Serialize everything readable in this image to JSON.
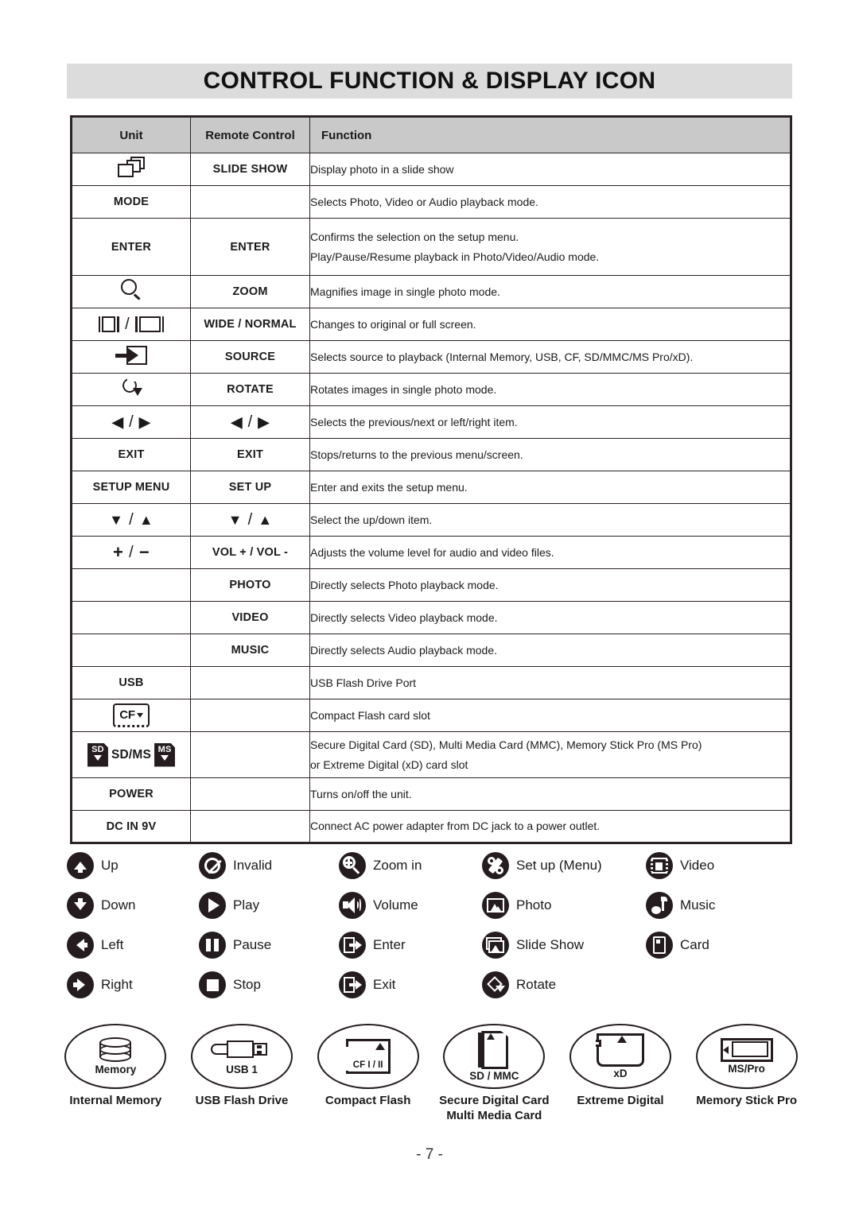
{
  "header": {
    "title": "CONTROL FUNCTION & DISPLAY ICON"
  },
  "table": {
    "columns": [
      "Unit",
      "Remote Control",
      "Function"
    ],
    "rows": [
      {
        "unit_icon": "slideshow-stack-icon",
        "unit": "",
        "remote": "SLIDE SHOW",
        "function": [
          "Display photo in a slide show"
        ]
      },
      {
        "unit_icon": "",
        "unit": "MODE",
        "remote": "",
        "function": [
          "Selects Photo, Video or Audio playback mode."
        ]
      },
      {
        "unit_icon": "",
        "unit": "ENTER",
        "remote": "ENTER",
        "function": [
          "Confirms the selection on the setup menu.",
          "Play/Pause/Resume playback in Photo/Video/Audio mode."
        ]
      },
      {
        "unit_icon": "magnifier-icon",
        "unit": "",
        "remote": "ZOOM",
        "function": [
          "Magnifies image in single photo mode."
        ]
      },
      {
        "unit_icon": "wide-normal-screen-icon",
        "unit": "",
        "remote": "WIDE / NORMAL",
        "function": [
          "Changes to original or full screen."
        ]
      },
      {
        "unit_icon": "source-arrow-icon",
        "unit": "",
        "remote": "SOURCE",
        "function": [
          "Selects source to playback (Internal Memory, USB, CF, SD/MMC/MS Pro/xD)."
        ]
      },
      {
        "unit_icon": "rotate-icon",
        "unit": "",
        "remote": "ROTATE",
        "function": [
          "Rotates images in single photo mode."
        ]
      },
      {
        "unit_icon": "left-right-arrows-icon",
        "unit": "",
        "remote_icon": "left-right-arrows-icon",
        "remote": "",
        "function": [
          "Selects the previous/next or left/right item."
        ]
      },
      {
        "unit_icon": "",
        "unit": "EXIT",
        "remote": "EXIT",
        "function": [
          "Stops/returns to the previous menu/screen."
        ]
      },
      {
        "unit_icon": "",
        "unit": "SETUP MENU",
        "remote": "SET UP",
        "function": [
          "Enter and exits the setup menu."
        ]
      },
      {
        "unit_icon": "down-up-arrows-icon",
        "unit": "",
        "remote_icon": "down-up-arrows-icon",
        "remote": "",
        "function": [
          "Select the up/down item."
        ]
      },
      {
        "unit_icon": "plus-minus-icon",
        "unit": "",
        "remote": "VOL + / VOL -",
        "function": [
          "Adjusts the volume level for audio and video files."
        ]
      },
      {
        "unit_icon": "",
        "unit": "",
        "remote": "PHOTO",
        "function": [
          "Directly selects Photo playback mode."
        ]
      },
      {
        "unit_icon": "",
        "unit": "",
        "remote": "VIDEO",
        "function": [
          "Directly selects Video playback mode."
        ]
      },
      {
        "unit_icon": "",
        "unit": "",
        "remote": "MUSIC",
        "function": [
          "Directly selects Audio playback mode."
        ]
      },
      {
        "unit_icon": "",
        "unit": "USB",
        "remote": "",
        "function": [
          "USB Flash Drive Port"
        ]
      },
      {
        "unit_icon": "cf-slot-icon",
        "unit": "",
        "remote": "",
        "function": [
          "Compact Flash card slot"
        ]
      },
      {
        "unit_icon": "sd-ms-slot-icon",
        "unit": "SD/MS",
        "remote": "",
        "function": [
          "Secure Digital Card (SD), Multi Media Card (MMC), Memory Stick Pro (MS Pro)",
          "or Extreme Digital (xD) card slot"
        ]
      },
      {
        "unit_icon": "",
        "unit": "POWER",
        "remote": "",
        "function": [
          "Turns on/off the unit."
        ]
      },
      {
        "unit_icon": "",
        "unit": "DC IN 9V",
        "remote": "",
        "function": [
          "Connect AC power adapter from DC jack to a power outlet."
        ]
      }
    ],
    "unit_glyph_labels": {
      "cf": "CF",
      "sd": "SD",
      "ms": "MS",
      "sdms": "SD/MS"
    }
  },
  "legend": {
    "items": [
      {
        "icon": "up-arrow-icon",
        "label": "Up"
      },
      {
        "icon": "invalid-icon",
        "label": "Invalid"
      },
      {
        "icon": "zoom-in-icon",
        "label": "Zoom in"
      },
      {
        "icon": "wrench-icon",
        "label": "Set up (Menu)"
      },
      {
        "icon": "film-icon",
        "label": "Video"
      },
      {
        "icon": "down-arrow-icon",
        "label": "Down"
      },
      {
        "icon": "play-icon",
        "label": "Play"
      },
      {
        "icon": "volume-icon",
        "label": "Volume"
      },
      {
        "icon": "photo-icon",
        "label": "Photo"
      },
      {
        "icon": "music-note-icon",
        "label": "Music"
      },
      {
        "icon": "left-arrow-icon",
        "label": "Left"
      },
      {
        "icon": "pause-icon",
        "label": "Pause"
      },
      {
        "icon": "enter-icon",
        "label": "Enter"
      },
      {
        "icon": "slide-show-icon",
        "label": "Slide Show"
      },
      {
        "icon": "card-icon",
        "label": "Card"
      },
      {
        "icon": "right-arrow-icon",
        "label": "Right"
      },
      {
        "icon": "stop-icon",
        "label": "Stop"
      },
      {
        "icon": "exit-icon",
        "label": "Exit"
      },
      {
        "icon": "rotate-icon",
        "label": "Rotate"
      },
      {
        "icon": "",
        "label": ""
      }
    ]
  },
  "media": {
    "items": [
      {
        "icon": "internal-memory-drum-icon",
        "badge": "Memory",
        "caption": "Internal Memory",
        "caption2": ""
      },
      {
        "icon": "usb-plug-icon",
        "badge": "USB 1",
        "caption": "USB Flash Drive",
        "caption2": ""
      },
      {
        "icon": "compact-flash-card-icon",
        "badge": "CF I / II",
        "caption": "Compact Flash",
        "caption2": ""
      },
      {
        "icon": "sd-card-icon",
        "badge": "SD / MMC",
        "caption": "Secure Digital Card",
        "caption2": "Multi Media Card"
      },
      {
        "icon": "xd-card-icon",
        "badge": "xD",
        "caption": "Extreme Digital",
        "caption2": ""
      },
      {
        "icon": "memory-stick-pro-icon",
        "badge": "MS/Pro",
        "caption": "Memory Stick Pro",
        "caption2": ""
      }
    ]
  },
  "footer": {
    "page_number": "- 7 -"
  },
  "colors": {
    "banner_bg": "#dcdcdc",
    "table_header_bg": "#c9c9c9",
    "ink": "#241c1f",
    "page_bg": "#ffffff"
  }
}
